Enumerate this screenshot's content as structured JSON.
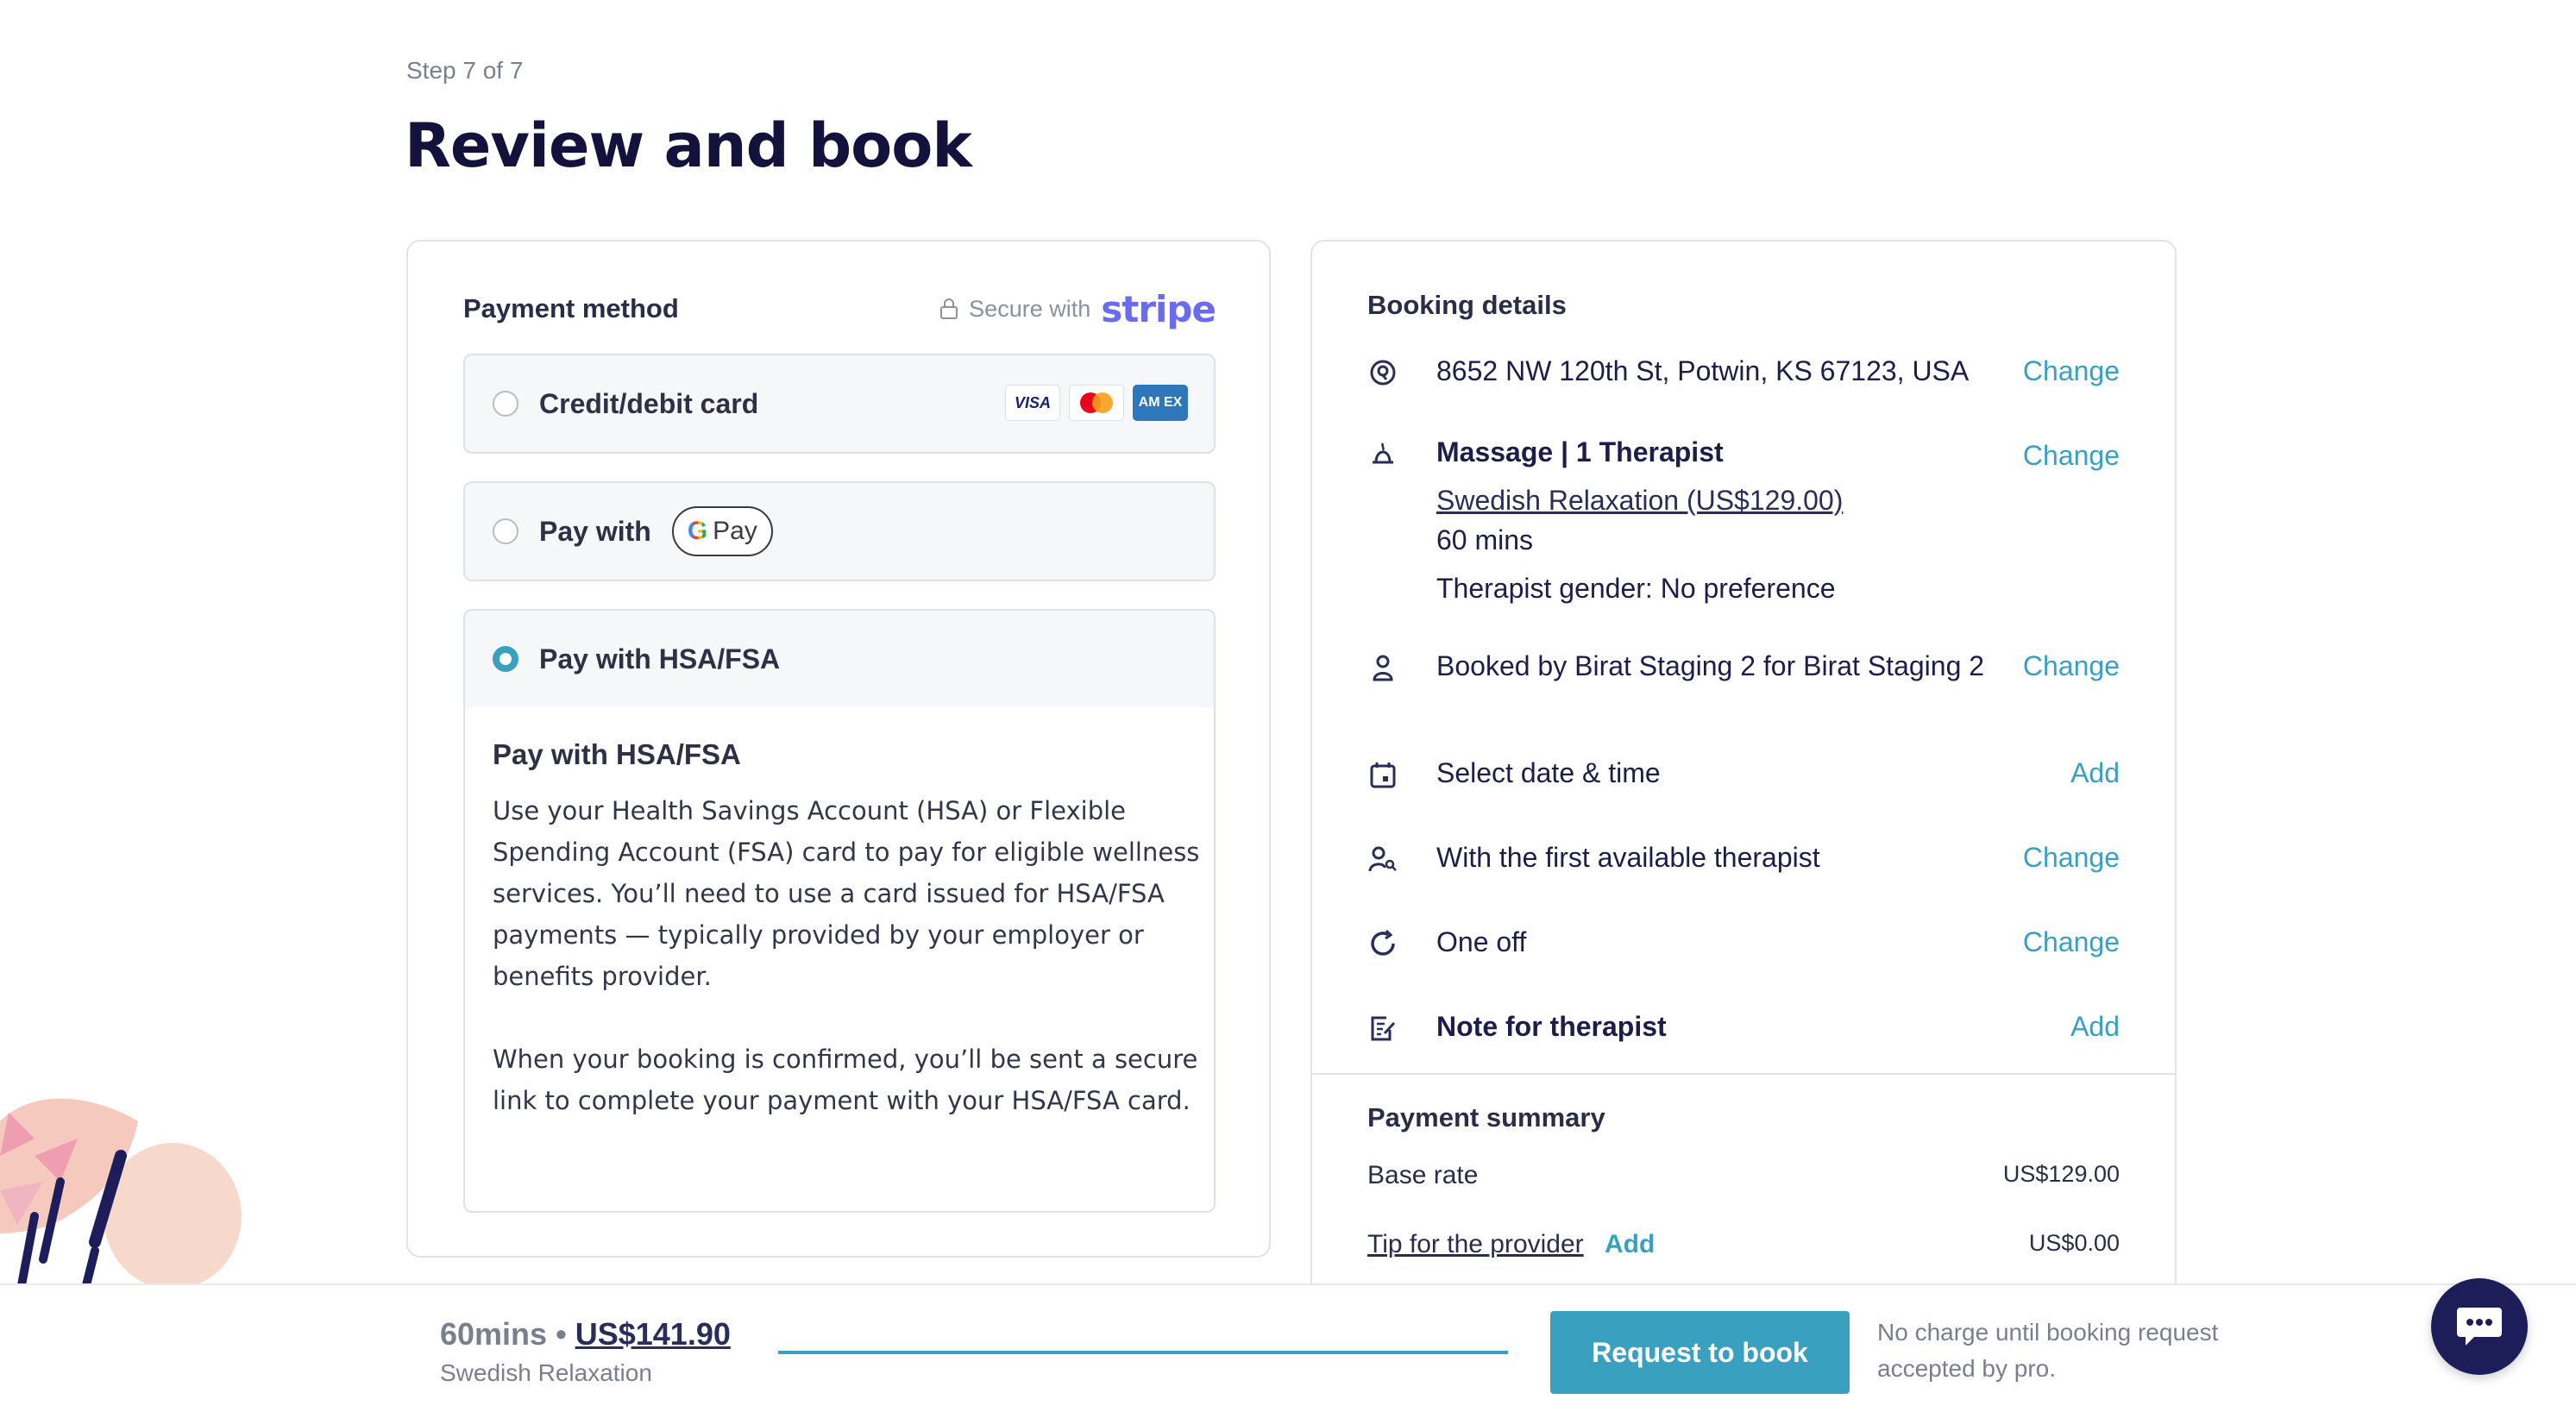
{
  "header": {
    "step": "Step 7 of 7",
    "title": "Review and book"
  },
  "payment": {
    "title": "Payment method",
    "secure_label": "Secure with",
    "stripe": "stripe",
    "options": [
      {
        "label": "Credit/debit card",
        "selected": false
      },
      {
        "label": "Pay with",
        "selected": false,
        "badge": "Pay",
        "badge_g": "G"
      },
      {
        "label": "Pay with HSA/FSA",
        "selected": true
      }
    ],
    "card_brands": {
      "visa": "VISA",
      "amex": "AM EX"
    },
    "hsa": {
      "title": "Pay with HSA/FSA",
      "p1": "Use your Health Savings Account (HSA) or Flexible Spending Account (FSA) card to pay for eligible wellness services. You’ll need to use a card issued for HSA/FSA payments — typically provided by your employer or benefits provider.",
      "p2": "When your booking is confirmed, you’ll be sent a secure link to complete your payment with your HSA/FSA card."
    }
  },
  "booking": {
    "title": "Booking details",
    "address": {
      "text": "8652 NW 120th St, Potwin, KS 67123, USA",
      "action": "Change"
    },
    "service": {
      "title": "Massage | 1 Therapist",
      "treatment": "Swedish Relaxation (US$129.00)",
      "duration": "60 mins",
      "gender": "Therapist gender: No preference",
      "action": "Change"
    },
    "booked_by": {
      "text": "Booked by Birat Staging 2 for Birat Staging 2",
      "action": "Change"
    },
    "date": {
      "text": "Select date & time",
      "action": "Add"
    },
    "therapist": {
      "text": "With the first available therapist",
      "action": "Change"
    },
    "frequency": {
      "text": "One off",
      "action": "Change"
    },
    "note": {
      "text": "Note for therapist",
      "action": "Add"
    }
  },
  "summary": {
    "title": "Payment summary",
    "base_label": "Base rate",
    "base_amount": "US$129.00",
    "tip_label": "Tip for the provider",
    "tip_action": "Add",
    "tip_amount": "US$0.00"
  },
  "footer": {
    "duration": "60mins",
    "separator": "•",
    "price": "US$141.90",
    "service": "Swedish Relaxation",
    "button": "Request to book",
    "note": "No charge until booking request accepted by pro."
  },
  "colors": {
    "accent": "#3aa0c0",
    "navy": "#12123d",
    "stripe": "#6b6bf0"
  }
}
